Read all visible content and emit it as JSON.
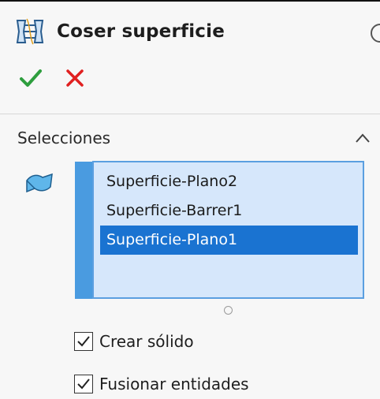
{
  "feature": {
    "title": "Coser superficie",
    "icon": "knit-surface-icon"
  },
  "actions": {
    "ok_icon": "checkmark-icon",
    "cancel_icon": "close-icon",
    "ok_color": "#2e9e3e",
    "cancel_color": "#e02020"
  },
  "selections": {
    "section_title": "Selecciones",
    "items": [
      {
        "label": "Superficie-Plano2",
        "selected": false
      },
      {
        "label": "Superficie-Barrer1",
        "selected": false
      },
      {
        "label": "Superficie-Plano1",
        "selected": true
      }
    ],
    "list_background": "#d6e7fb",
    "selected_color": "#1a73d1"
  },
  "options": [
    {
      "label": "Crear sólido",
      "checked": true
    },
    {
      "label": "Fusionar entidades",
      "checked": true
    }
  ]
}
